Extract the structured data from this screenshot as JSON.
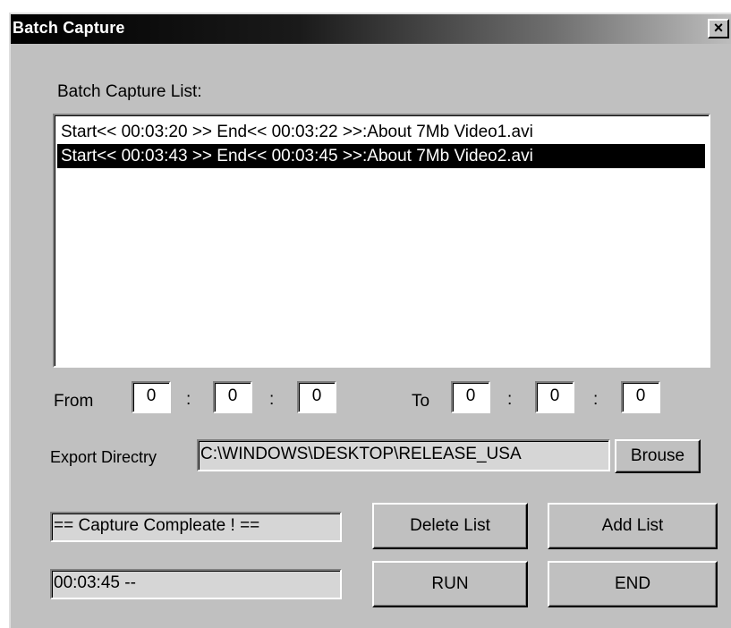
{
  "window": {
    "title": "Batch Capture",
    "close_symbol": "×"
  },
  "list": {
    "label": "Batch Capture List:",
    "items": [
      {
        "text": "Start<< 00:03:20 >> End<< 00:03:22 >>:About   7Mb Video1.avi",
        "selected": false
      },
      {
        "text": "Start<< 00:03:43 >> End<< 00:03:45 >>:About   7Mb Video2.avi",
        "selected": true
      }
    ]
  },
  "time_range": {
    "from_label": "From",
    "to_label": "To",
    "separator": ":",
    "from": [
      "0",
      "0",
      "0"
    ],
    "to": [
      "0",
      "0",
      "0"
    ]
  },
  "export": {
    "label": "Export Directry",
    "path": "C:\\WINDOWS\\DESKTOP\\RELEASE_USA",
    "browse_label": "Brouse"
  },
  "status": {
    "message": "== Capture Compleate ! ==",
    "time": "00:03:45 --"
  },
  "buttons": {
    "delete_list": "Delete List",
    "add_list": "Add List",
    "run": "RUN",
    "end": "END"
  },
  "colors": {
    "face": "#c0c0c0",
    "selection": "#000000",
    "titlebar_start": "#000000",
    "titlebar_end": "#bdbdbd"
  },
  "icons": {
    "close": "close-icon"
  }
}
